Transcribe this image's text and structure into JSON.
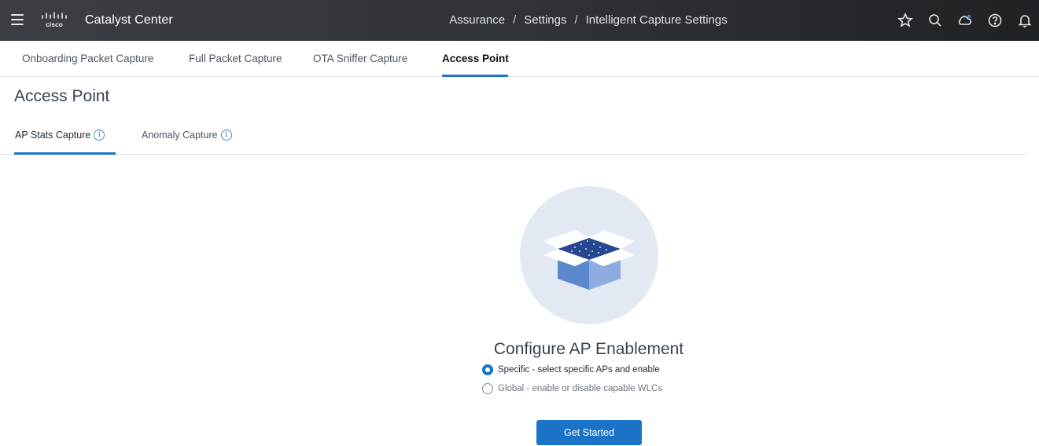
{
  "header": {
    "logo_text": "cisco",
    "app_title": "Catalyst Center",
    "breadcrumb": [
      "Assurance",
      "Settings",
      "Intelligent Capture Settings"
    ],
    "breadcrumb_separator": "/",
    "icons": [
      "star-icon",
      "search-icon",
      "cloud-icon",
      "help-icon",
      "bell-icon"
    ]
  },
  "tabs": [
    {
      "label": "Onboarding Packet Capture",
      "active": false
    },
    {
      "label": "Full Packet Capture",
      "active": false
    },
    {
      "label": "OTA Sniffer Capture",
      "active": false
    },
    {
      "label": "Access Point",
      "active": true
    }
  ],
  "page": {
    "title": "Access Point",
    "subtabs": [
      {
        "label": "AP Stats Capture",
        "active": true
      },
      {
        "label": "Anomaly Capture",
        "active": false
      }
    ],
    "info_glyph": "i"
  },
  "empty_state": {
    "title": "Configure AP Enablement",
    "options": [
      {
        "label": "Specific - select specific APs and enable",
        "checked": true
      },
      {
        "label": "Global - enable or disable capable WLCs",
        "checked": false
      }
    ],
    "button_label": "Get Started"
  },
  "colors": {
    "accent": "#1b74c9",
    "topbar": "#2e3236",
    "illustration_bg": "#e3e9f3"
  }
}
